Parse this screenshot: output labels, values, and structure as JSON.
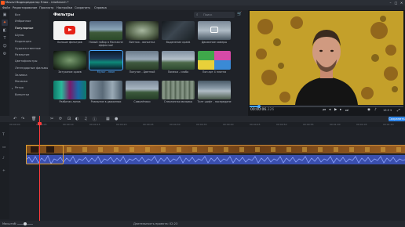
{
  "window": {
    "title": "Movavi Видеоредактор Плюс - intoSearch *"
  },
  "menu": [
    "Файл",
    "Редактирование",
    "Просмотр",
    "Настройки",
    "Сохранить",
    "Справка"
  ],
  "categories": {
    "items": [
      {
        "label": "Все",
        "active": false
      },
      {
        "label": "Избранное",
        "active": false
      },
      {
        "label": "Популярные",
        "active": true
      },
      {
        "label": "Шумы",
        "active": false
      },
      {
        "label": "Коррекция",
        "active": false
      },
      {
        "label": "Художественные",
        "active": false
      },
      {
        "label": "Размытие",
        "active": false
      },
      {
        "label": "Цветофильтры",
        "active": false
      },
      {
        "label": "Легендарные фильмы",
        "active": false
      },
      {
        "label": "Заливка",
        "active": false
      },
      {
        "label": "Мозаика",
        "active": false
      },
      {
        "label": "Ретро",
        "active": false
      },
      {
        "label": "Виньетки",
        "active": false
      }
    ]
  },
  "filters_panel": {
    "title": "Фильтры",
    "search_placeholder": "Поиск",
    "thumbnails": [
      {
        "label": "Больше фильтров"
      },
      {
        "label": "Новый набор в Магазине эффектов!"
      },
      {
        "label": "Винтаж - виньетка"
      },
      {
        "label": "Выделение краев"
      },
      {
        "label": "Движение камеры"
      },
      {
        "label": "Затухание краев"
      },
      {
        "label": "Мульт - неон",
        "selected": true
      },
      {
        "label": "Полутон - Цветной"
      },
      {
        "label": "Помехи - слабо"
      },
      {
        "label": "Поп арт 4 платна"
      },
      {
        "label": "Разбитая линза"
      },
      {
        "label": "Размытие в движении"
      },
      {
        "label": "Самолётики"
      },
      {
        "label": "Стеклянная мозаика"
      },
      {
        "label": "Тилт шифт - посередине"
      }
    ]
  },
  "preview": {
    "time_main": "00:00:06.",
    "time_ms": "326",
    "zoom": "16:9 ▾",
    "progress": 0.06
  },
  "timeline": {
    "export_label": "Сохранить",
    "ruler_ticks": [
      "00:00:00",
      "00:00:05",
      "00:00:10",
      "00:00:15",
      "00:00:20",
      "00:00:25",
      "00:00:30",
      "00:00:35",
      "00:00:40",
      "00:00:45",
      "00:00:50",
      "00:00:55",
      "00:01:00",
      "00:01:05",
      "00:01:10"
    ]
  },
  "statusbar": {
    "zoom_label": "Масштаб:",
    "duration": "Длительность проекта: 02:23"
  },
  "colors": {
    "accent": "#ff6b2b",
    "selected_text": "#4aa8ff",
    "playhead": "#ff3b3b",
    "audio": "#3a4fae",
    "export": "#2f86ea"
  }
}
